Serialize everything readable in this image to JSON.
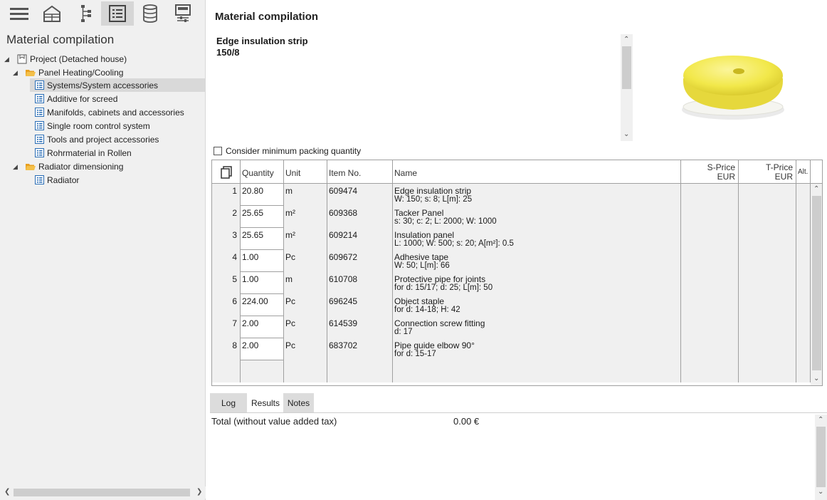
{
  "toolbar": {
    "buttons": [
      {
        "icon": "menu-icon"
      },
      {
        "icon": "house-icon"
      },
      {
        "icon": "network-icon"
      },
      {
        "icon": "list-icon",
        "active": true
      },
      {
        "icon": "database-icon"
      },
      {
        "icon": "settings-panel-icon"
      }
    ]
  },
  "sidebar": {
    "title": "Material compilation",
    "tree": {
      "root": "Project (Detached house)",
      "folder1": "Panel Heating/Cooling",
      "items": [
        "Systems/System accessories",
        "Additive for screed",
        "Manifolds, cabinets and accessories",
        "Single room control system",
        "Tools and project accessories",
        "Rohrmaterial in Rollen"
      ],
      "folder2": "Radiator dimensioning",
      "folder2_items": [
        "Radiator"
      ]
    }
  },
  "main": {
    "title": "Material compilation",
    "detail_name": "Edge insulation strip",
    "detail_size": "150/8",
    "pack_label": "Consider minimum packing quantity",
    "columns": {
      "quantity": "Quantity",
      "unit": "Unit",
      "item_no": "Item No.",
      "name": "Name",
      "sprice": "S-Price",
      "sprice_cur": "EUR",
      "tprice": "T-Price",
      "tprice_cur": "EUR",
      "alt": "Alt."
    },
    "rows": [
      {
        "n": "1",
        "qty": "20.80",
        "unit": "m",
        "item": "609474",
        "name": "Edge insulation strip",
        "spec": "W: 150;  s: 8;  L[m]: 25"
      },
      {
        "n": "2",
        "qty": "25.65",
        "unit": "m²",
        "item": "609368",
        "name": "Tacker Panel",
        "spec": "s: 30;  c: 2;  L: 2000;  W: 1000"
      },
      {
        "n": "3",
        "qty": "25.65",
        "unit": "m²",
        "item": "609214",
        "name": "Insulation panel",
        "spec": "L: 1000;  W: 500;  s: 20;  A[m²]: 0.5"
      },
      {
        "n": "4",
        "qty": "1.00",
        "unit": "Pc",
        "item": "609672",
        "name": "Adhesive tape",
        "spec": "W: 50;  L[m]: 66"
      },
      {
        "n": "5",
        "qty": "1.00",
        "unit": "m",
        "item": "610708",
        "name": "Protective pipe for joints",
        "spec": "for d: 15/17;  d: 25;  L[m]: 50"
      },
      {
        "n": "6",
        "qty": "224.00",
        "unit": "Pc",
        "item": "696245",
        "name": "Object staple",
        "spec": "for d: 14-18;  H: 42"
      },
      {
        "n": "7",
        "qty": "2.00",
        "unit": "Pc",
        "item": "614539",
        "name": "Connection screw fitting",
        "spec": "d: 17"
      },
      {
        "n": "8",
        "qty": "2.00",
        "unit": "Pc",
        "item": "683702",
        "name": "Pipe guide elbow 90°",
        "spec": "for d: 15-17"
      }
    ],
    "tabs": {
      "log": "Log",
      "results": "Results",
      "notes": "Notes"
    },
    "total_label": "Total (without value added tax)",
    "total_value": "0.00 €"
  },
  "colors": {
    "folder": "#e8a020",
    "list_icon": "#2a6db5",
    "selection": "#d9d9d9",
    "product": "#f2e84a"
  }
}
